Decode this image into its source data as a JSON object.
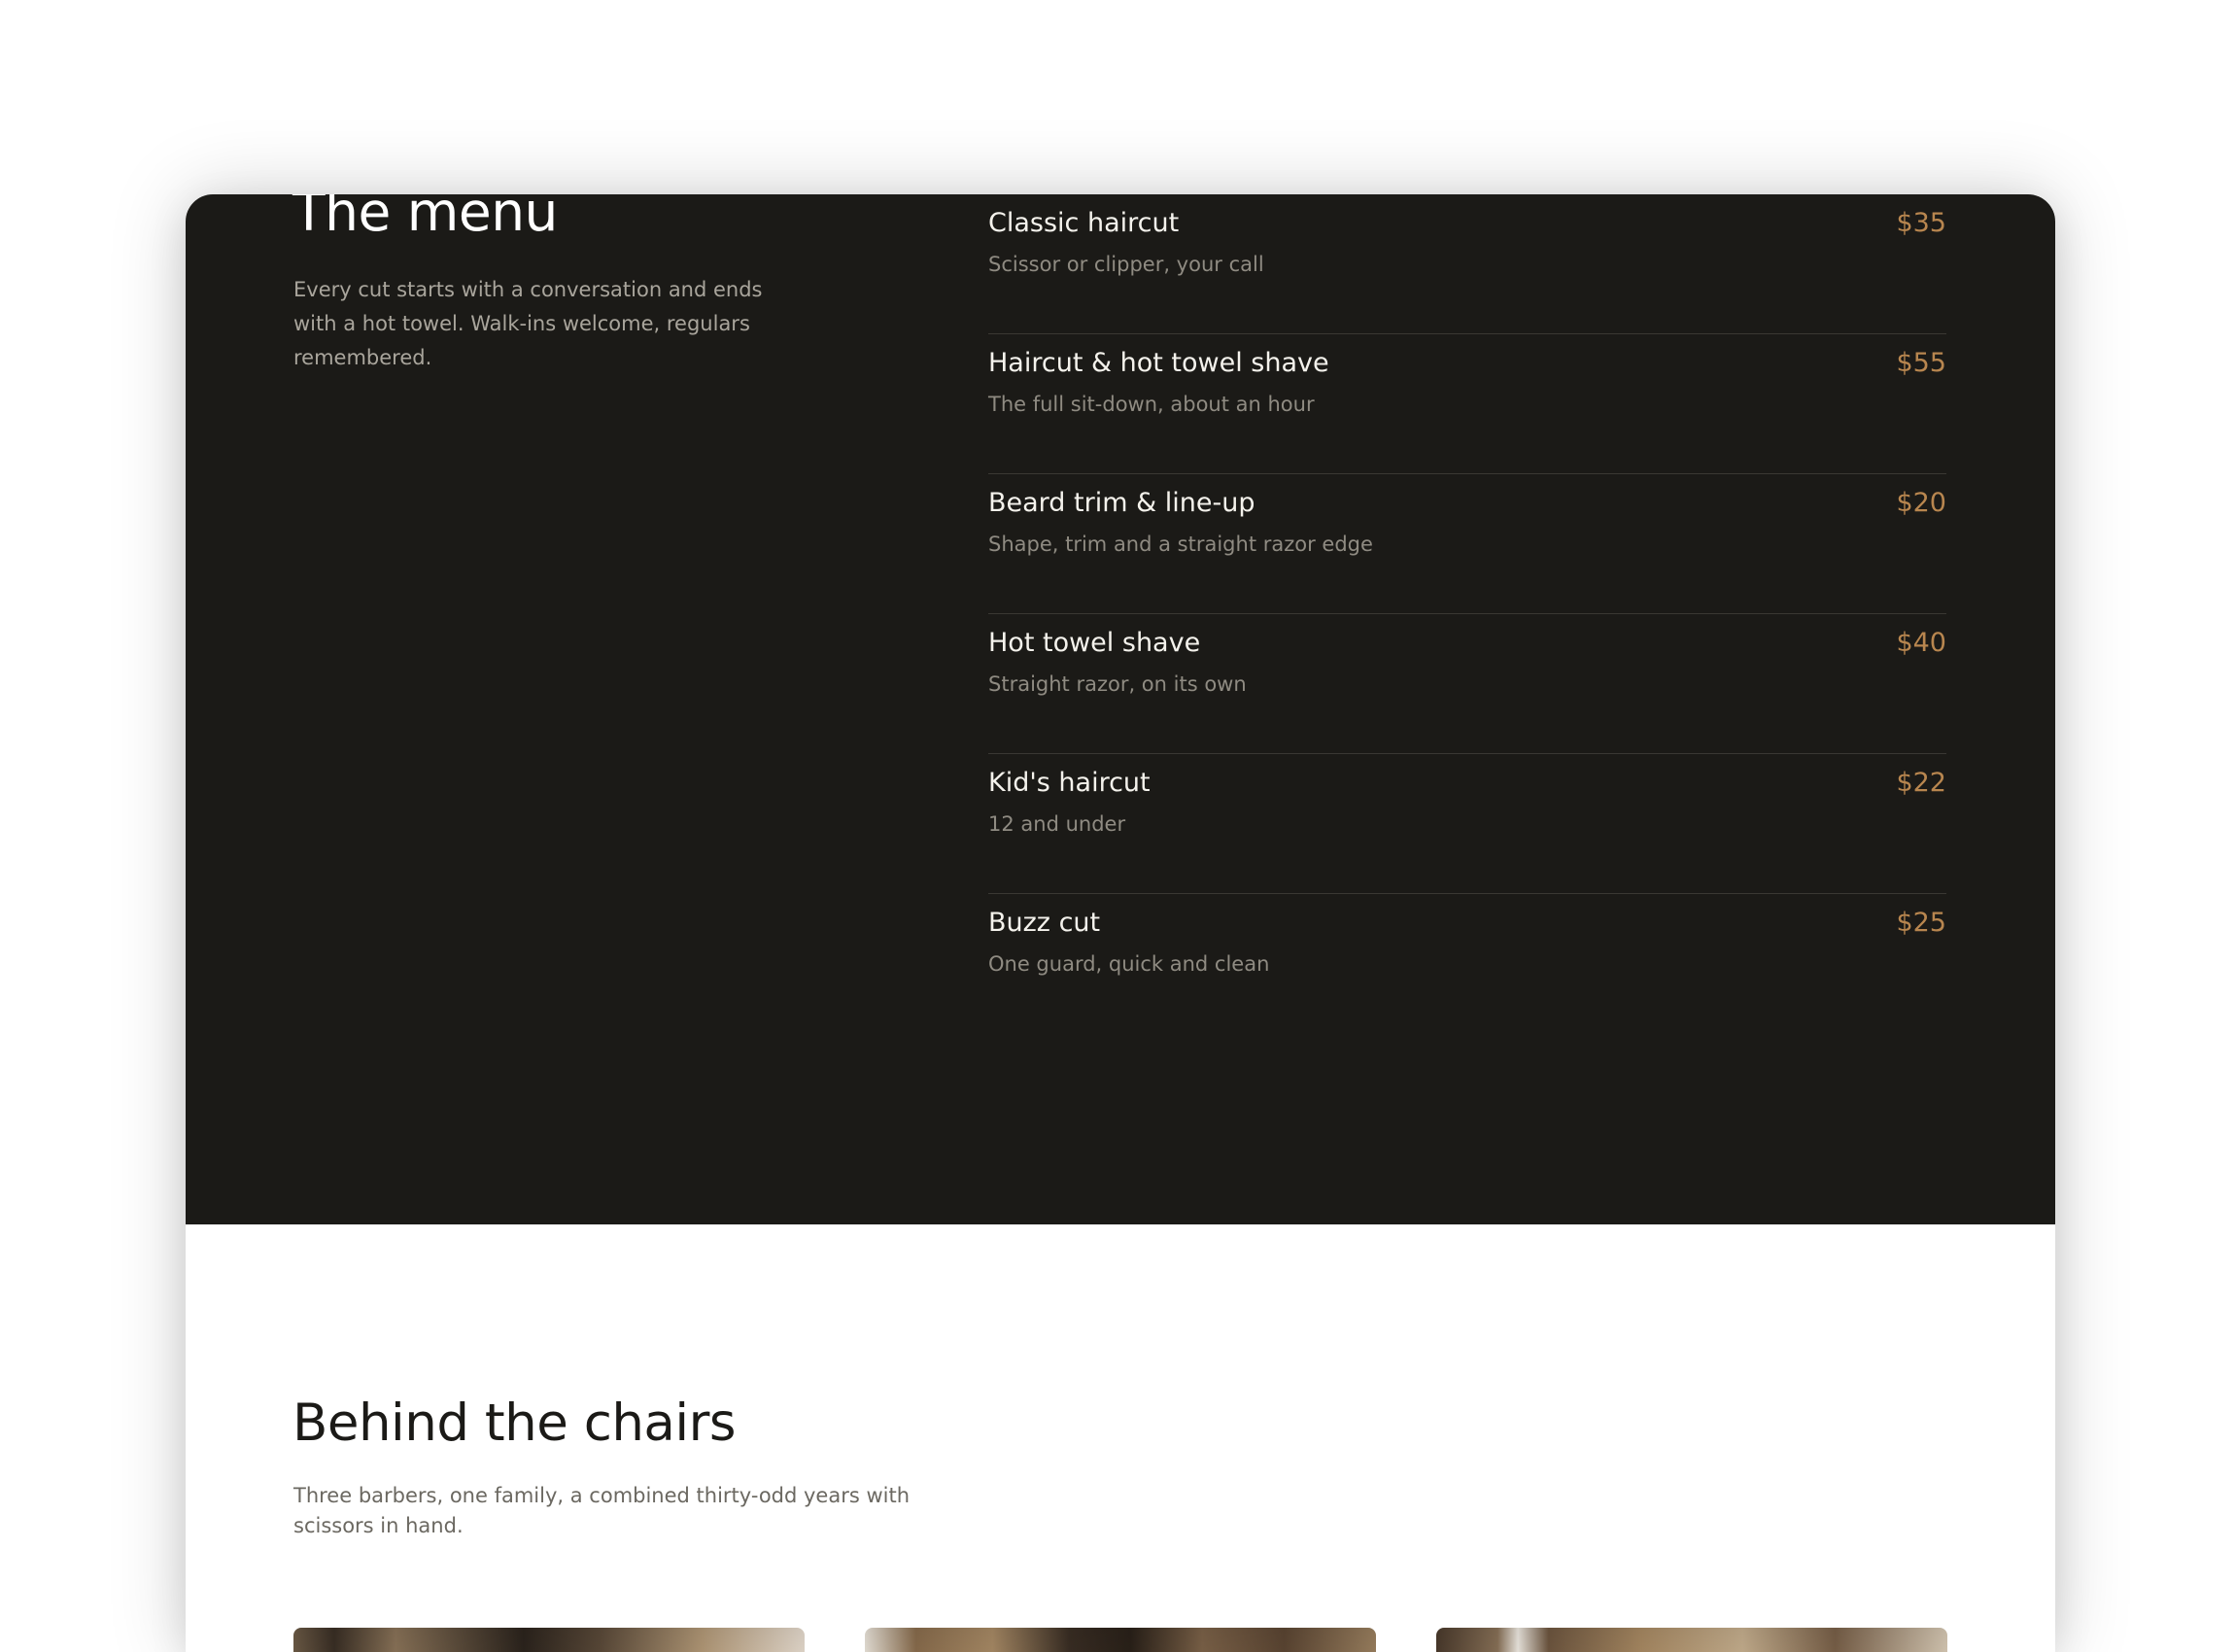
{
  "menu": {
    "title": "The menu",
    "intro": "Every cut starts with a conversation and ends with a hot towel. Walk-ins welcome, regulars remembered.",
    "accent_color": "#b8864f",
    "background_color": "#1b1a17",
    "items": [
      {
        "name": "Classic haircut",
        "description": "Scissor or clipper, your call",
        "price": "$35"
      },
      {
        "name": "Haircut & hot towel shave",
        "description": "The full sit-down, about an hour",
        "price": "$55"
      },
      {
        "name": "Beard trim & line-up",
        "description": "Shape, trim and a straight razor edge",
        "price": "$20"
      },
      {
        "name": "Hot towel shave",
        "description": "Straight razor, on its own",
        "price": "$40"
      },
      {
        "name": "Kid's haircut",
        "description": "12 and under",
        "price": "$22"
      },
      {
        "name": "Buzz cut",
        "description": "One guard, quick and clean",
        "price": "$25"
      }
    ]
  },
  "team": {
    "title": "Behind the chairs",
    "intro": "Three barbers, one family, a combined thirty-odd years with scissors in hand."
  }
}
